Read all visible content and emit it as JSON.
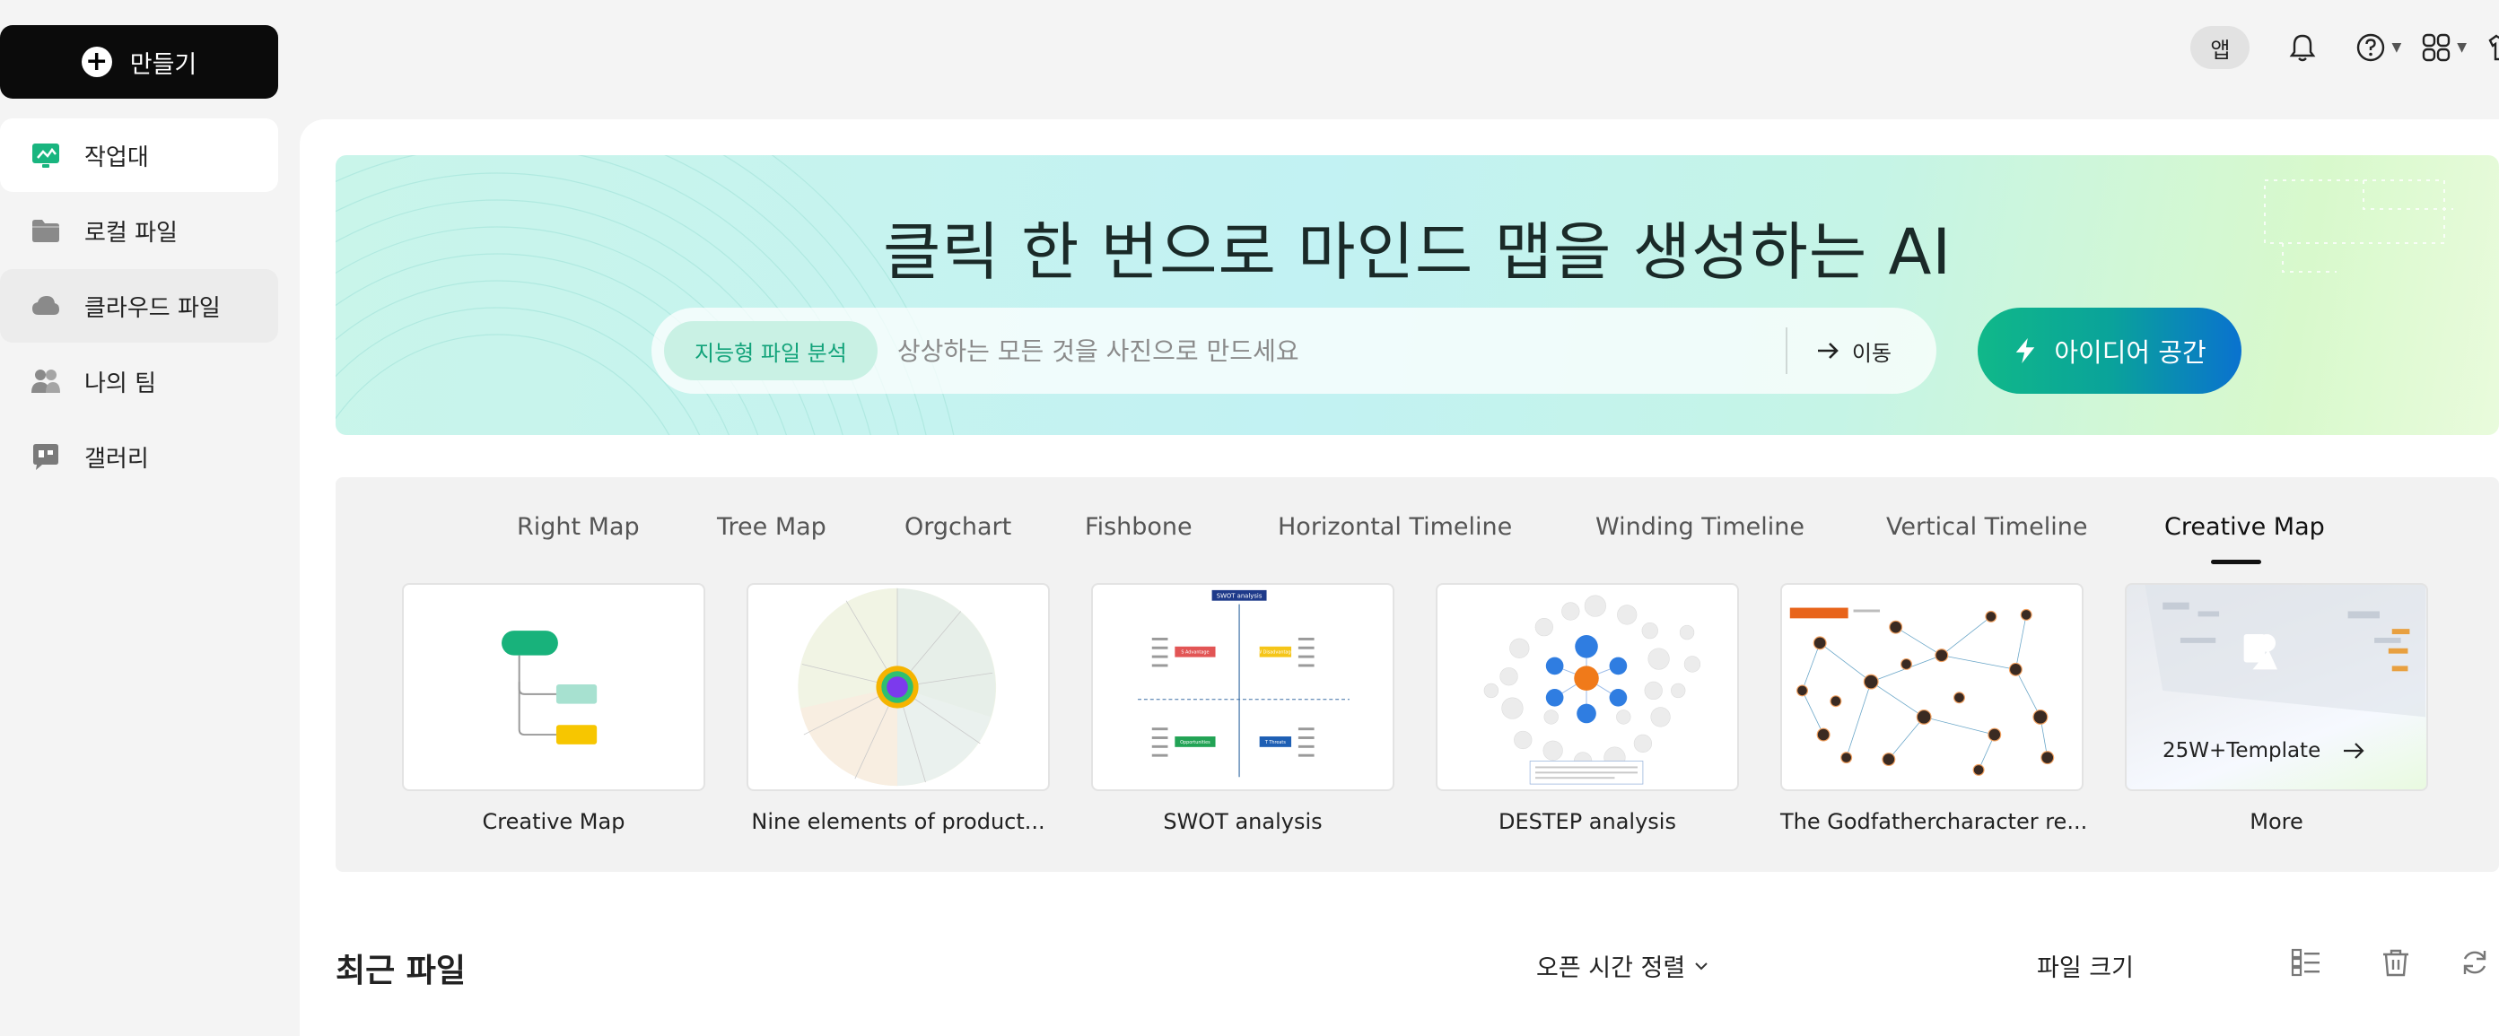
{
  "sidebar": {
    "create_label": "만들기",
    "items": [
      {
        "label": "작업대",
        "icon": "workbench-icon"
      },
      {
        "label": "로컬 파일",
        "icon": "folder-icon"
      },
      {
        "label": "클라우드 파일",
        "icon": "cloud-icon"
      },
      {
        "label": "나의 팀",
        "icon": "team-icon"
      },
      {
        "label": "갤러리",
        "icon": "gallery-icon"
      }
    ]
  },
  "topbar": {
    "app_label": "앱",
    "icons": [
      "bell-icon",
      "help-icon",
      "apps-grid-icon",
      "shirt-icon"
    ]
  },
  "hero": {
    "title": "클릭 한 번으로 마인드 맵을 생성하는 AI",
    "chip_label": "지능형 파일 분석",
    "search_placeholder": "상상하는 모든 것을 사진으로 만드세요",
    "go_label": "이동",
    "idea_label": "아이디어 공간"
  },
  "templates": {
    "tabs": [
      "Right Map",
      "Tree Map",
      "Orgchart",
      "Fishbone",
      "Horizontal Timeline",
      "Winding Timeline",
      "Vertical Timeline",
      "Creative Map"
    ],
    "active_tab": "Creative Map",
    "cards": [
      {
        "label": "Creative Map"
      },
      {
        "label": "Nine elements of product..."
      },
      {
        "label": "SWOT analysis",
        "thumb_title": "SWOT analysis",
        "thumb_labels": [
          "S Advantage",
          "W Disadvantage",
          "Opportunities",
          "T Threats"
        ]
      },
      {
        "label": "DESTEP analysis"
      },
      {
        "label": "The Godfathercharacter re..."
      },
      {
        "label": "More",
        "overlay": "25W+Template"
      }
    ]
  },
  "recent": {
    "title": "최근 파일",
    "sort_label": "오픈 시간 정렬",
    "size_label": "파일 크기"
  },
  "colors": {
    "accent_green": "#10b889",
    "accent_blue": "#0a72cf",
    "dark": "#0b0b0b"
  }
}
